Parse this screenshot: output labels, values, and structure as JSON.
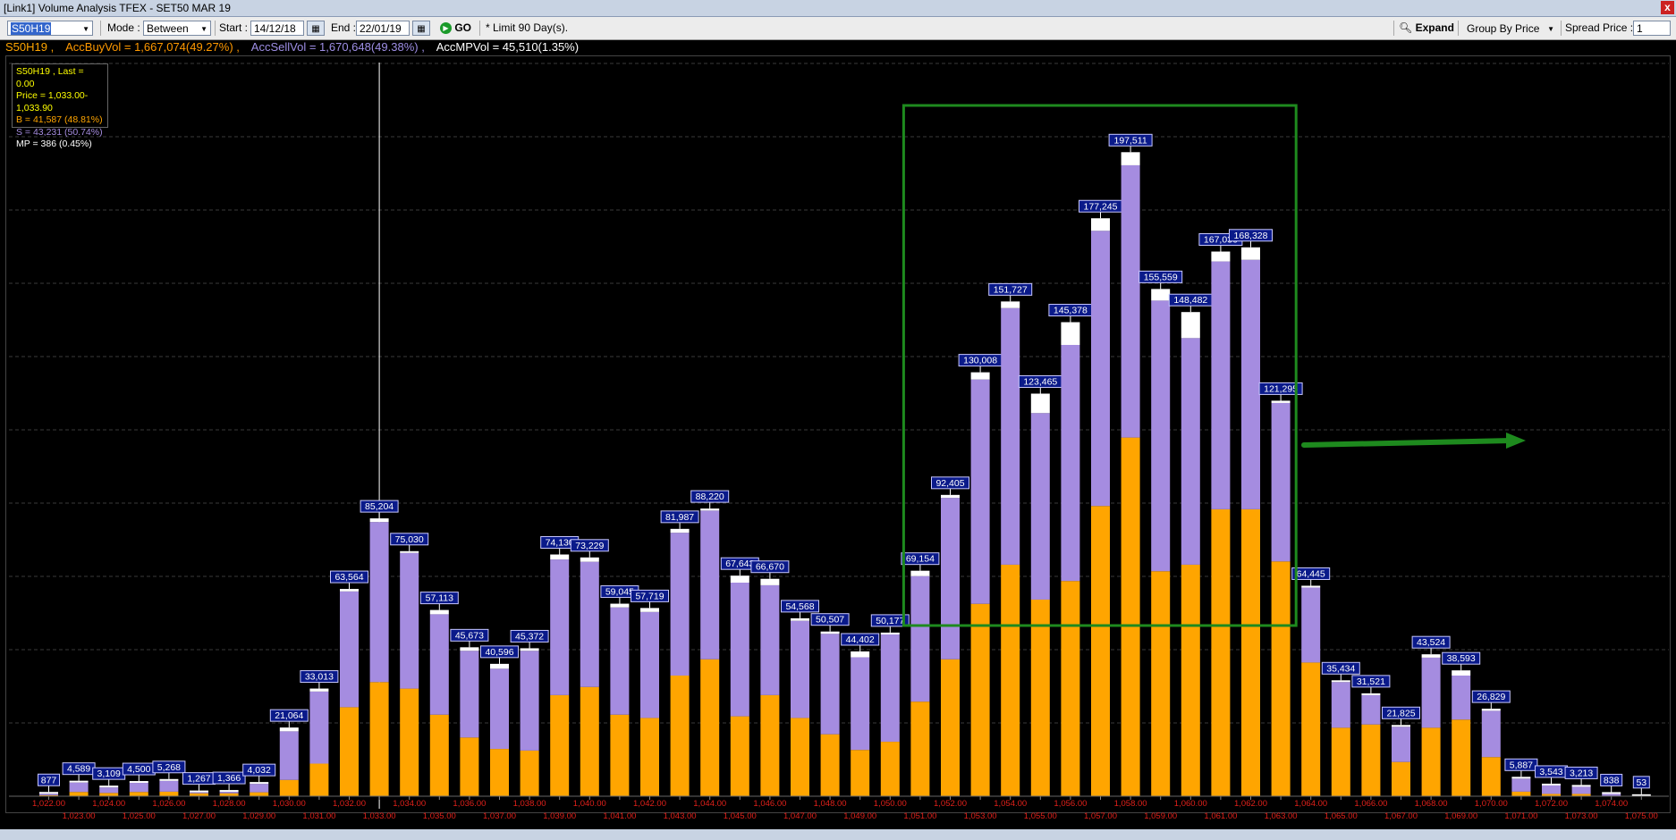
{
  "window": {
    "title": "[Link1] Volume Analysis TFEX - SET50 MAR 19",
    "close_glyph": "x"
  },
  "toolbar": {
    "symbol": "S50H19",
    "mode_label": "Mode :",
    "mode_value": "Between",
    "start_label": "Start :",
    "start_value": "14/12/18",
    "end_label": "End :",
    "end_value": "22/01/19",
    "go_label": "GO",
    "limit_note": "* Limit 90 Day(s).",
    "expand_label": "Expand",
    "group_by_value": "Group By Price",
    "spread_label": "Spread Price :",
    "spread_value": "1"
  },
  "summary": {
    "symbol": "S50H19 ,",
    "acc_buy": "AccBuyVol = 1,667,074(49.27%) ,",
    "acc_sell": "AccSellVol = 1,670,648(49.38%) ,",
    "acc_mp": "AccMPVol = 45,510(1.35%)"
  },
  "infobox": {
    "line1": "S50H19 , Last = 0.00",
    "line2": "Price = 1,033.00-1,033.90",
    "line3": "B = 41,587 (48.81%)",
    "line4": "S = 43,231 (50.74%)",
    "line5": "MP = 386 (0.45%)"
  },
  "colors": {
    "buy": "#ffa500",
    "sell": "#a58ce0",
    "mp": "#ffffff",
    "label_bg": "#0a1a8a",
    "tick": "#e0201a",
    "highlight": "#1e8a1e",
    "summary_buy": "#ff9900",
    "summary_sell": "#9f8fe6",
    "summary_sym": "#ffa500"
  },
  "chart_data": {
    "type": "bar",
    "stacked": true,
    "ylim": [
      0,
      225000
    ],
    "grid": true,
    "series_order": [
      "buy",
      "sell",
      "mp"
    ],
    "totals": [
      "877",
      "4,589",
      "3,109",
      "4,500",
      "5,268",
      "1,267",
      "1,366",
      "4,032",
      "21,064",
      "33,013",
      "63,564",
      "85,204",
      "75,030",
      "57,113",
      "45,673",
      "40,596",
      "45,372",
      "74,130",
      "73,229",
      "59,045",
      "57,719",
      "81,987",
      "88,220",
      "67,643",
      "66,670",
      "54,568",
      "50,507",
      "44,402",
      "50,177",
      "69,154",
      "92,405",
      "130,008",
      "151,727",
      "123,465",
      "145,378",
      "177,245",
      "197,511",
      "155,559",
      "148,482",
      "167,036",
      "168,328",
      "121,295",
      "64,445",
      "35,434",
      "31,521",
      "21,825",
      "43,524",
      "38,593",
      "26,829",
      "5,887",
      "3,543",
      "3,213",
      "838",
      "53"
    ],
    "buy": [
      300,
      1300,
      1000,
      1300,
      1400,
      900,
      900,
      1200,
      5000,
      10000,
      27300,
      35000,
      33000,
      25000,
      18000,
      14500,
      14000,
      31000,
      33500,
      25000,
      24000,
      37000,
      42000,
      24500,
      31000,
      24000,
      19000,
      14200,
      16700,
      29000,
      42000,
      59000,
      71000,
      60300,
      66000,
      89000,
      110000,
      69000,
      71000,
      88000,
      88000,
      72000,
      41000,
      21000,
      22000,
      10500,
      21000,
      23500,
      12000,
      1400,
      700,
      700,
      150,
      20
    ],
    "sell": [
      450,
      2900,
      1700,
      2800,
      3300,
      300,
      450,
      2600,
      14900,
      22100,
      35500,
      49100,
      41600,
      30800,
      26600,
      24600,
      30600,
      41600,
      38400,
      32900,
      32500,
      43800,
      45600,
      41000,
      33700,
      29800,
      30800,
      28400,
      32900,
      38500,
      49500,
      68800,
      78700,
      57200,
      72400,
      84400,
      83500,
      83000,
      69500,
      76000,
      76500,
      48600,
      23000,
      14000,
      9000,
      10800,
      21500,
      13500,
      14200,
      4000,
      2600,
      2200,
      550,
      25
    ],
    "mp": [
      127,
      389,
      409,
      400,
      568,
      67,
      16,
      232,
      1164,
      913,
      764,
      1104,
      430,
      1313,
      1073,
      1496,
      772,
      1530,
      1329,
      1145,
      1219,
      1187,
      620,
      2143,
      1970,
      768,
      707,
      1802,
      577,
      1654,
      905,
      2208,
      2027,
      5965,
      6978,
      3845,
      4011,
      3559,
      7982,
      3036,
      3828,
      695,
      445,
      434,
      521,
      525,
      1024,
      1593,
      629,
      487,
      243,
      313,
      138,
      8
    ],
    "x_tick_labels": [
      "1,022.00",
      "1,023.00",
      "1,024.00",
      "1,025.00",
      "1,026.00",
      "1,027.00",
      "1,028.00",
      "1,029.00",
      "1,030.00",
      "1,031.00",
      "1,032.00",
      "1,033.00",
      "1,034.00",
      "1,035.00",
      "1,036.00",
      "1,037.00",
      "1,038.00",
      "1,039.00",
      "1,040.00",
      "1,041.00",
      "1,042.00",
      "1,043.00",
      "1,044.00",
      "1,045.00",
      "1,046.00",
      "1,047.00",
      "1,048.00",
      "1,049.00",
      "1,050.00",
      "1,051.00",
      "1,052.00",
      "1,053.00",
      "1,054.00",
      "1,055.00",
      "1,056.00",
      "1,057.00",
      "1,058.00",
      "1,059.00",
      "1,060.00",
      "1,061.00",
      "1,062.00",
      "1,063.00",
      "1,064.00",
      "1,065.00",
      "1,066.00",
      "1,067.00",
      "1,068.00",
      "1,069.00",
      "1,070.00",
      "1,071.00",
      "1,072.00",
      "1,073.00",
      "1,074.00",
      "1,075.00"
    ],
    "cursor_index": 11,
    "highlight_range": [
      29,
      42
    ]
  }
}
